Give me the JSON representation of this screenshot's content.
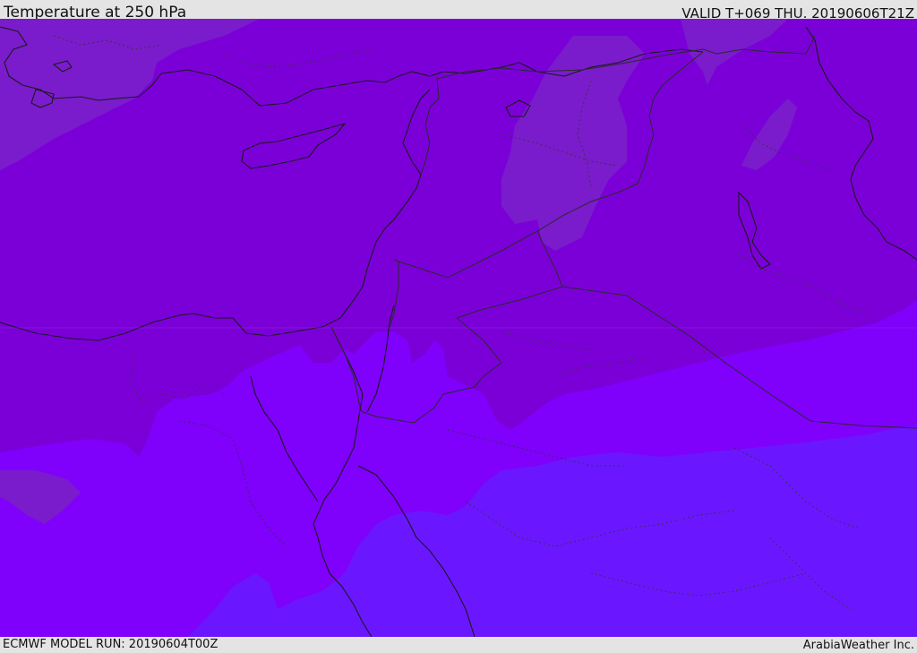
{
  "header": {
    "title": "Temperature at 250 hPa",
    "valid": "VALID T+069 THU. 20190606T21Z"
  },
  "footer": {
    "model_run": "ECMWF MODEL RUN: 20190604T00Z",
    "credit": "ArabiaWeather Inc."
  },
  "colors": {
    "band_warm": "#7a1ccb",
    "band_mid": "#7b00d8",
    "band_cool": "#7f00fb",
    "band_coolest": "#6a17ff",
    "coastline": "#1a1a1a",
    "border": "#2a2a2a"
  }
}
